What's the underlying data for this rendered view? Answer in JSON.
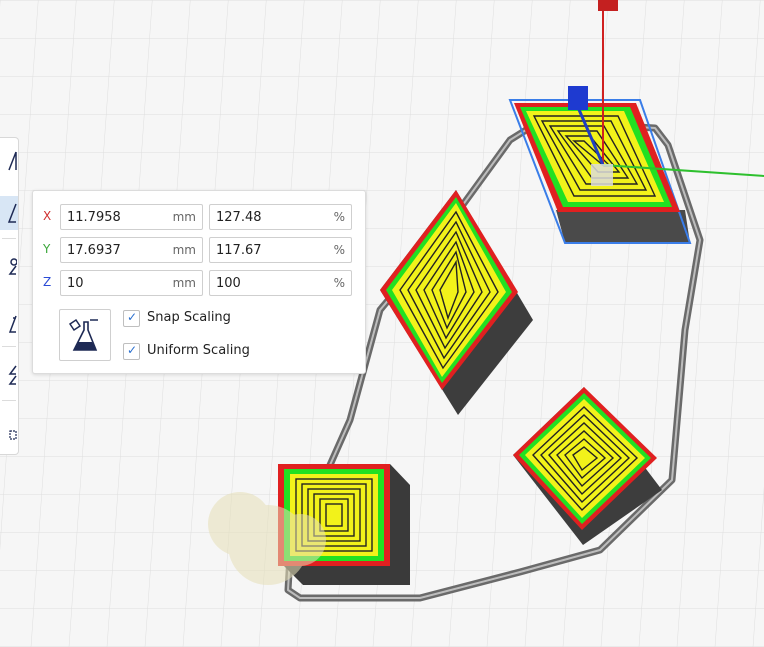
{
  "scale_panel": {
    "rows": [
      {
        "axis": "X",
        "axis_color": "#d03030",
        "size": "11.7958",
        "size_unit": "mm",
        "percent": "127.48",
        "percent_unit": "%"
      },
      {
        "axis": "Y",
        "axis_color": "#3aa63a",
        "size": "17.6937",
        "size_unit": "mm",
        "percent": "117.67",
        "percent_unit": "%"
      },
      {
        "axis": "Z",
        "axis_color": "#2b4bd6",
        "size": "10",
        "size_unit": "mm",
        "percent": "100",
        "percent_unit": "%"
      }
    ],
    "lock_icon": "lock-model-icon",
    "snap_scaling": {
      "label": "Snap Scaling",
      "checked": true
    },
    "uniform_scaling": {
      "label": "Uniform Scaling",
      "checked": true
    }
  },
  "toolbar": {
    "tools": [
      {
        "icon": "move-tool-icon",
        "active": false
      },
      {
        "icon": "scale-tool-icon",
        "active": true
      },
      {
        "icon": "rotate-tool-icon",
        "active": false
      },
      {
        "icon": "mirror-tool-icon",
        "active": false
      },
      {
        "icon": "per-model-settings-icon",
        "active": false
      },
      {
        "icon": "support-blocker-icon",
        "active": false
      }
    ]
  },
  "colors": {
    "grid_bg": "#f6f6f6",
    "outer_wall": "#e02020",
    "inner_wall": "#22e022",
    "infill": "#f2f21a",
    "travel": "#555555",
    "selection": "#3a7de8"
  }
}
